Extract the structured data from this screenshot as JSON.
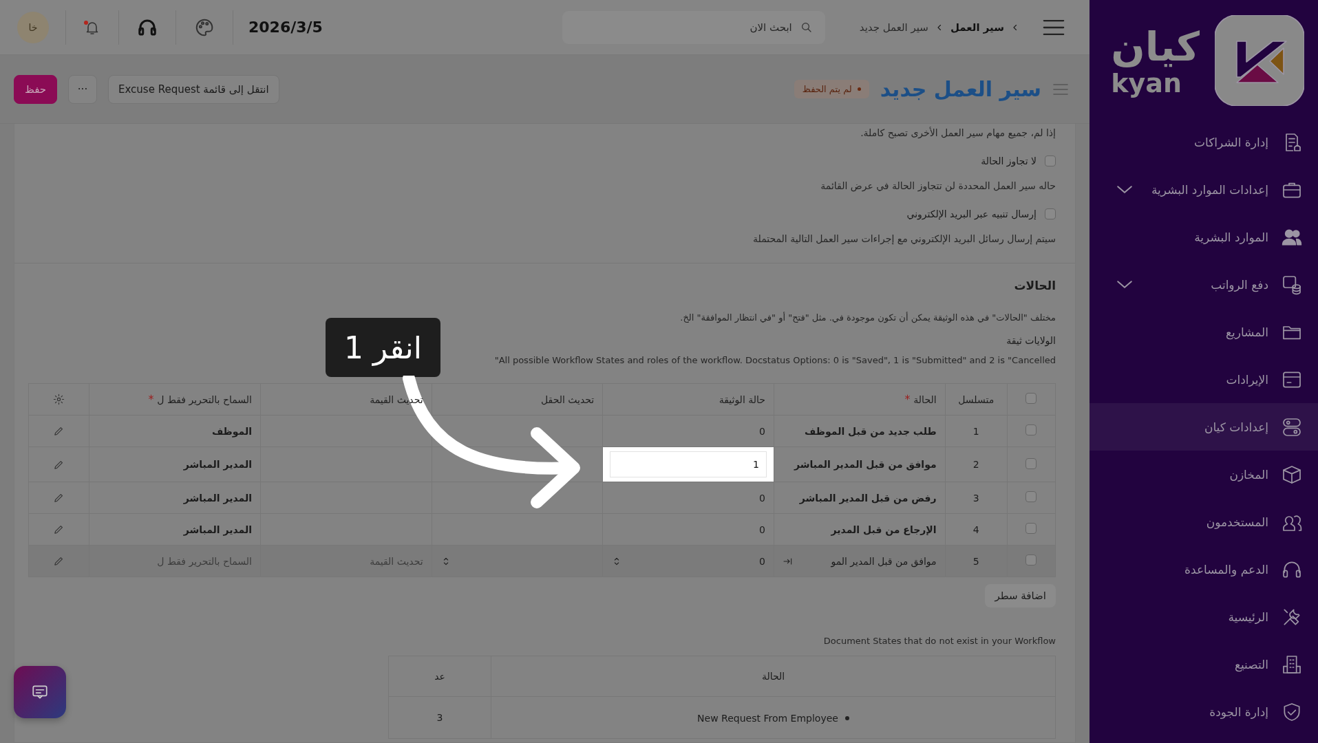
{
  "topbar": {
    "breadcrumbs": [
      "سير العمل",
      "سير العمل جديد"
    ],
    "search": {
      "placeholder": "ابحث الان"
    },
    "date": "2026/3/5",
    "notifications": {
      "unread": true
    },
    "avatar": "خا"
  },
  "header": {
    "title": "سير العمل جديد",
    "status": "لم يتم الحفظ",
    "buttons": [
      {
        "label": "انتقل إلى قائمة Excuse Request",
        "kind": "default"
      },
      {
        "label": "···",
        "kind": "menu"
      },
      {
        "label": "حفظ",
        "kind": "primary"
      }
    ]
  },
  "form": {
    "intro": "إذا لم، جميع مهام سير العمل الأخرى تصبح كاملة.",
    "options": [
      {
        "label": "لا تجاوز الحالة",
        "checked": false,
        "description": "حاله سير العمل المحددة لن تتجاوز الحالة في عرض القائمة"
      },
      {
        "label": "إرسال تنبيه عبر البريد الإلكتروني",
        "checked": false,
        "description": "سيتم إرسال رسائل البريد الإلكتروني مع إجراءات سير العمل التالية المحتملة"
      }
    ]
  },
  "states_section": {
    "title": "الحالات",
    "description": "مختلف \"الحالات\" في هذه الوثيقة يمكن أن تكون موجودة في. مثل \"فتح\" أو \"في انتظار الموافقة\" الخ.",
    "field_label": "الولايات ثيقة",
    "help": "All possible Workflow States and roles of the workflow. Docstatus Options: 0 is \"Saved\", 1 is \"Submitted\" and 2 is \"Cancelled\"",
    "table": {
      "select_all": false,
      "columns": [
        {
          "label": "متسلسل",
          "required": false
        },
        {
          "label": "الحالة",
          "required": true
        },
        {
          "label": "حالة الوثيقة",
          "required": false
        },
        {
          "label": "تحديث الحقل",
          "required": false
        },
        {
          "label": "تحديث القيمة",
          "required": false
        },
        {
          "label": "السماح بالتحرير فقط ل",
          "required": true
        }
      ],
      "rows": [
        {
          "kind": "row",
          "no": "1",
          "state": "طلب جديد من قبل الموظف",
          "doc_status": "0",
          "allow_edit": "الموظف",
          "selected": false,
          "spotlight": false
        },
        {
          "kind": "row",
          "no": "2",
          "state": "موافق من قبل المدير المباشر",
          "doc_status": "1",
          "allow_edit": "المدير المباشر",
          "selected": false,
          "spotlight": true
        },
        {
          "kind": "row",
          "no": "3",
          "state": "رفض من قبل المدير المباشر",
          "doc_status": "0",
          "allow_edit": "المدير المباشر",
          "selected": false,
          "spotlight": false
        },
        {
          "kind": "row",
          "no": "4",
          "state": "الإرجاع من قبل المدير",
          "doc_status": "0",
          "allow_edit": "المدير المباشر",
          "selected": false,
          "spotlight": false
        },
        {
          "kind": "editing",
          "no": "5",
          "state": "موافق من قبل المدير المو",
          "doc_status": "0",
          "update_value_placeholder": "تحديث القيمة",
          "allow_edit_placeholder": "السماح بالتحرير فقط ل",
          "selected": false,
          "spotlight": false
        }
      ]
    },
    "add_row": "اضافة سطر"
  },
  "missing_states": {
    "title": "Document States that do not exist in your Workflow",
    "columns": [
      "الحالة",
      "عد"
    ],
    "rows": [
      {
        "state": "New Request From Employee",
        "count": "3"
      }
    ]
  },
  "tutorial": {
    "callout": "انقر 1"
  },
  "sidebar": {
    "brand_ar": "كيان",
    "brand_en": "kyan",
    "items": [
      {
        "label": "إدارة الشراكات",
        "expandable": false,
        "selected": false
      },
      {
        "label": "إعدادات الموارد البشرية",
        "expandable": true,
        "selected": false
      },
      {
        "label": "الموارد البشرية",
        "expandable": false,
        "selected": false
      },
      {
        "label": "دفع الرواتب",
        "expandable": true,
        "selected": false
      },
      {
        "label": "المشاريع",
        "expandable": false,
        "selected": false
      },
      {
        "label": "الإيرادات",
        "expandable": false,
        "selected": false
      },
      {
        "label": "إعدادات كيان",
        "expandable": false,
        "selected": true
      },
      {
        "label": "المخازن",
        "expandable": false,
        "selected": false
      },
      {
        "label": "المستخدمون",
        "expandable": false,
        "selected": false
      },
      {
        "label": "الدعم والمساعدة",
        "expandable": false,
        "selected": false
      },
      {
        "label": "الرئيسية",
        "expandable": false,
        "selected": false
      },
      {
        "label": "التصنيع",
        "expandable": false,
        "selected": false
      },
      {
        "label": "إدارة الجودة",
        "expandable": false,
        "selected": false
      }
    ]
  }
}
